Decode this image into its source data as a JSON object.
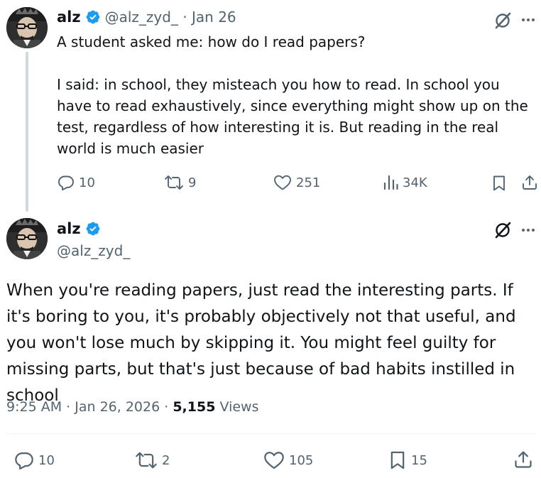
{
  "parent_tweet": {
    "display_name": "alz",
    "handle": "@alz_zyd_",
    "separator": "·",
    "date": "Jan 26",
    "text_line1": "A student asked me: how do I read papers?",
    "text_paragraph2": "I said: in school, they misteach you how to read. In school you have to read exhaustively, since everything might show up on the test, regardless of how interesting it is. But reading in the real world is much easier",
    "actions": {
      "replies": "10",
      "reposts": "9",
      "likes": "251",
      "views": "34K"
    }
  },
  "main_tweet": {
    "display_name": "alz",
    "handle": "@alz_zyd_",
    "text": "When you're reading papers, just read the interesting parts. If it's boring to you, it's probably objectively not that useful, and you won't lose much by skipping it. You might feel guilty for missing parts, but that's just because of bad habits instilled in school",
    "time": "9:25 AM",
    "sep1": "·",
    "date": "Jan 26, 2026",
    "sep2": "·",
    "views_count": "5,155",
    "views_label": "Views",
    "actions": {
      "replies": "10",
      "reposts": "2",
      "likes": "105",
      "bookmarks": "15"
    }
  },
  "colors": {
    "verified_blue": "#1d9bf0",
    "muted_gray": "#536471",
    "text_dark": "#0f1419"
  },
  "icons": [
    "grok-icon",
    "more-icon",
    "reply-icon",
    "repost-icon",
    "like-icon",
    "views-icon",
    "bookmark-icon",
    "share-icon",
    "verified-badge-icon"
  ]
}
